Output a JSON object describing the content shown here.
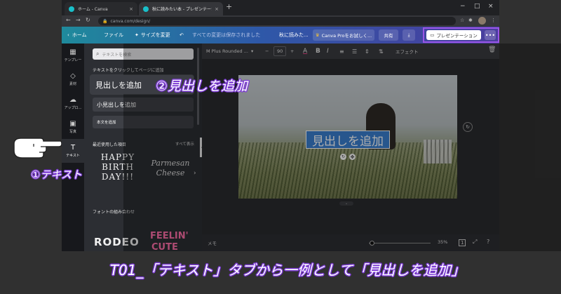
{
  "browser": {
    "tabs": [
      {
        "title": "ホーム - Canva",
        "close": "×"
      },
      {
        "title": "秋に読みたい本 - プレゼンテーション",
        "close": "×"
      }
    ],
    "new_tab": "+",
    "window_controls": [
      "−",
      "□",
      "×"
    ],
    "nav": {
      "back": "←",
      "forward": "→",
      "reload": "↻"
    },
    "address": "canva.com/design/"
  },
  "header": {
    "home": "ホーム",
    "file": "ファイル",
    "resize": "サイズを変更",
    "undo_icon": "↶",
    "save_status": "すべての変更は保存されました",
    "doc_title": "秋に読みた...",
    "pro_trial": "Canva Proをお試しく...",
    "share": "共有",
    "present": "プレゼンテーション",
    "more": "•••"
  },
  "sidenav": {
    "items": [
      {
        "label": "テンプレー",
        "icon": "▦"
      },
      {
        "label": "素材",
        "icon": "◇"
      },
      {
        "label": "アップロ...",
        "icon": "☁"
      },
      {
        "label": "写真",
        "icon": "▣"
      },
      {
        "label": "テキスト",
        "icon": "T"
      }
    ]
  },
  "panel": {
    "search_placeholder": "テキストを検索",
    "click_to_add": "テキストをクリックしてページに追加",
    "add_heading": "見出しを追加",
    "add_subheading": "小見出しを追加",
    "add_body": "本文を追加",
    "recent_title": "最近使用した項目",
    "see_all": "すべて表示",
    "recent_items": [
      {
        "lines": [
          "HAPPY",
          "BIRTH",
          "DAY!!!"
        ]
      },
      {
        "lines": [
          "Parmesan",
          "Cheese"
        ]
      }
    ],
    "combos_title": "フォントの組み合わせ",
    "combos": [
      "RODEO",
      "FEELIN'",
      "CUTE"
    ],
    "chevron": "›",
    "collapse": "‹"
  },
  "toolbar": {
    "font": "M Plus Rounded ...",
    "font_size": "90",
    "size_minus": "−",
    "size_plus": "+",
    "color_icon": "A",
    "bold": "B",
    "italic": "I",
    "effects": "エフェクト",
    "colors": {
      "accent": "#3a7fd0",
      "highlight_border": "#9a55e6"
    }
  },
  "canvas": {
    "headline": "見出しを追加",
    "zoom": "35%",
    "memo": "メモ",
    "page": "1"
  },
  "annotations": {
    "step1": "①テキスト",
    "step2": "②見出しを追加",
    "caption": "T01_「テキスト」タブから一例として「見出しを追加」"
  }
}
